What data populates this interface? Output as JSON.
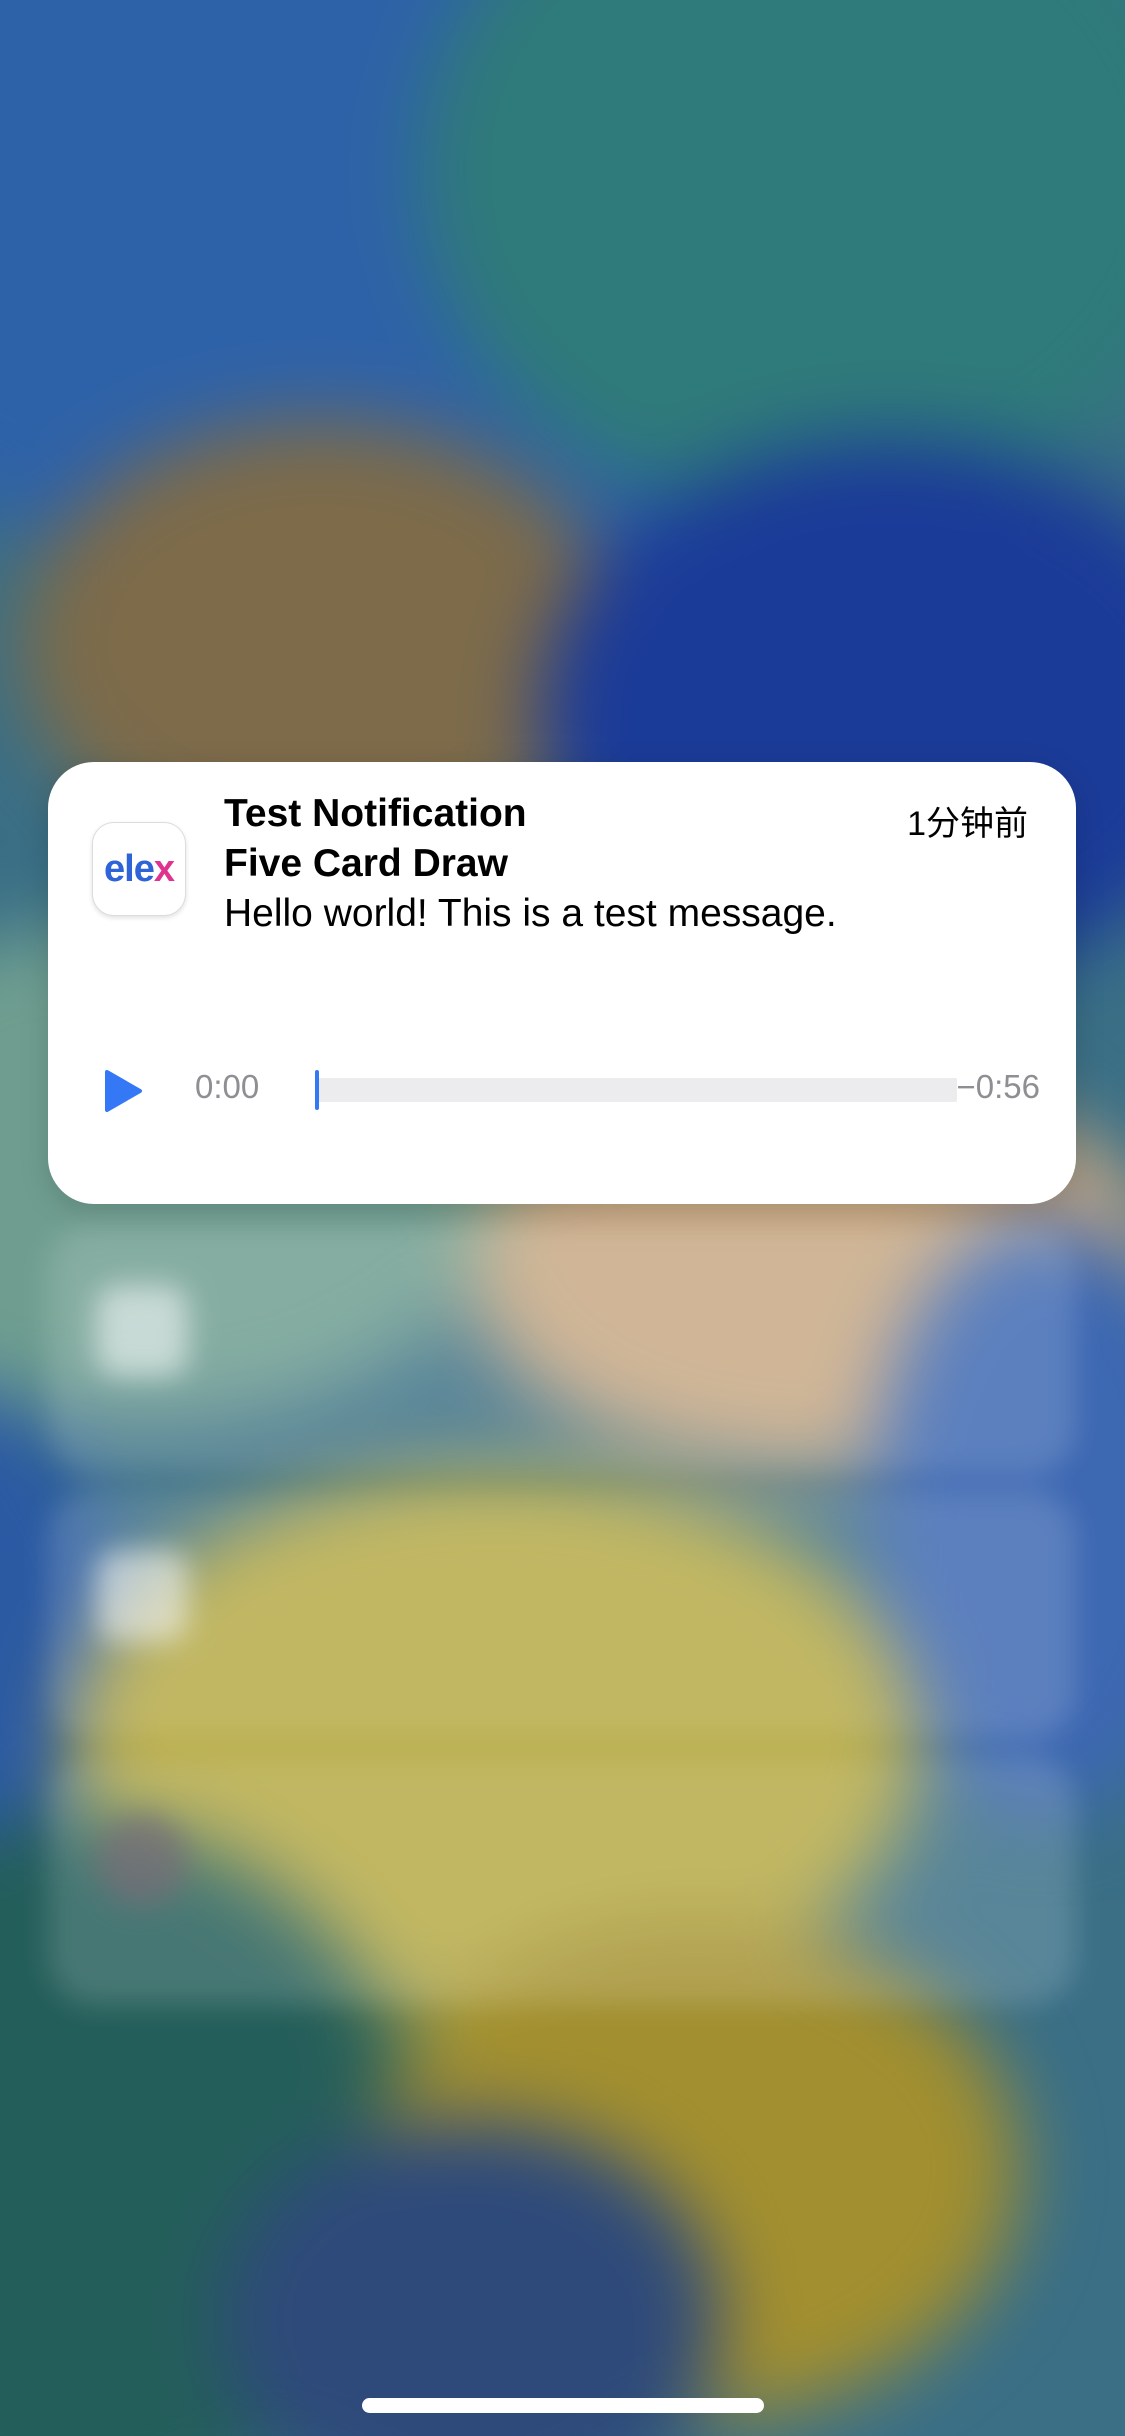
{
  "notification": {
    "app_icon": {
      "logo_prefix": "ele",
      "logo_suffix": "x",
      "name": "elex-app-icon"
    },
    "title": "Test Notification",
    "subtitle": "Five Card Draw",
    "body": "Hello world! This is a test message.",
    "time": "1分钟前",
    "player": {
      "elapsed": "0:00",
      "remaining": "−0:56",
      "progress": 0.0,
      "play_icon": "play-icon"
    }
  },
  "colors": {
    "accent": "#3478f6",
    "logo_blue": "#2f64d8",
    "logo_pink": "#e0338f",
    "time_gray": "#8e8e93"
  }
}
